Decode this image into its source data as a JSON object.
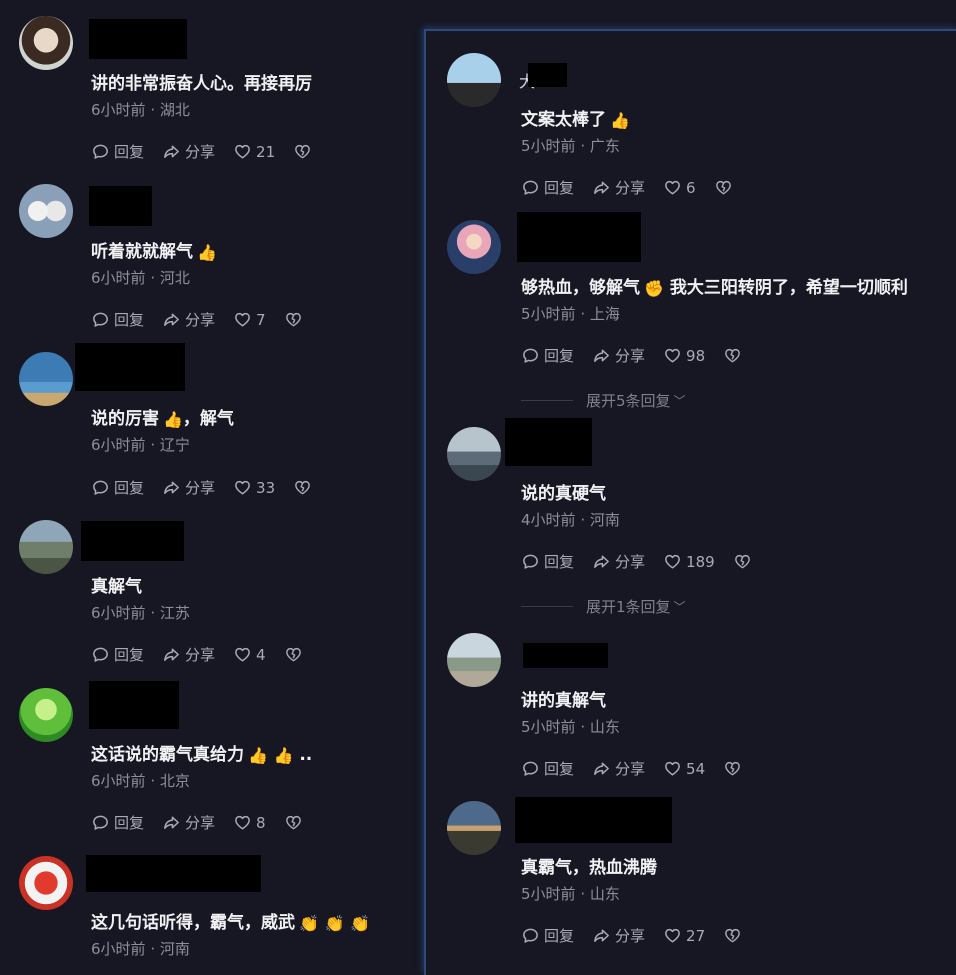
{
  "actions": {
    "reply": "回复",
    "share": "分享"
  },
  "left_comments": [
    {
      "text": "讲的非常振奋人心。再接再厉",
      "time": "6小时前",
      "location": "湖北",
      "likes": "21"
    },
    {
      "text": "听着就就解气",
      "emoji": "👍",
      "time": "6小时前",
      "location": "河北",
      "likes": "7"
    },
    {
      "text": "说的厉害",
      "emoji": "👍",
      "text_after": "，解气",
      "time": "6小时前",
      "location": "辽宁",
      "likes": "33"
    },
    {
      "text": "真解气",
      "time": "6小时前",
      "location": "江苏",
      "likes": "4"
    },
    {
      "text": "这话说的霸气真给力",
      "emoji": "👍 👍",
      "text_after": "..",
      "time": "6小时前",
      "location": "北京",
      "likes": "8"
    },
    {
      "text": "这几句话听得，霸气，威武",
      "emoji": "👏 👏 👏",
      "time": "6小时前",
      "location": "河南"
    }
  ],
  "right_comments": [
    {
      "name_fragment": "大",
      "text": "文案太棒了",
      "emoji": "👍",
      "time": "5小时前",
      "location": "广东",
      "likes": "6"
    },
    {
      "text": "够热血，够解气",
      "emoji": "✊",
      "text_after": "我大三阳转阴了，希望一切顺利",
      "time": "5小时前",
      "location": "上海",
      "likes": "98",
      "expand": "展开5条回复"
    },
    {
      "text": "说的真硬气",
      "time": "4小时前",
      "location": "河南",
      "likes": "189",
      "expand": "展开1条回复"
    },
    {
      "text": "讲的真解气",
      "time": "5小时前",
      "location": "山东",
      "likes": "54"
    },
    {
      "text": "真霸气，热血沸腾",
      "time": "5小时前",
      "location": "山东",
      "likes": "27"
    }
  ],
  "colors": {
    "background": "#161722",
    "panel_border": "#2f4a7a",
    "text_primary": "#f1f1f4",
    "text_meta": "#8d8e99"
  },
  "icons": [
    "comment-icon",
    "share-icon",
    "heart-icon",
    "dislike-heart-icon"
  ]
}
